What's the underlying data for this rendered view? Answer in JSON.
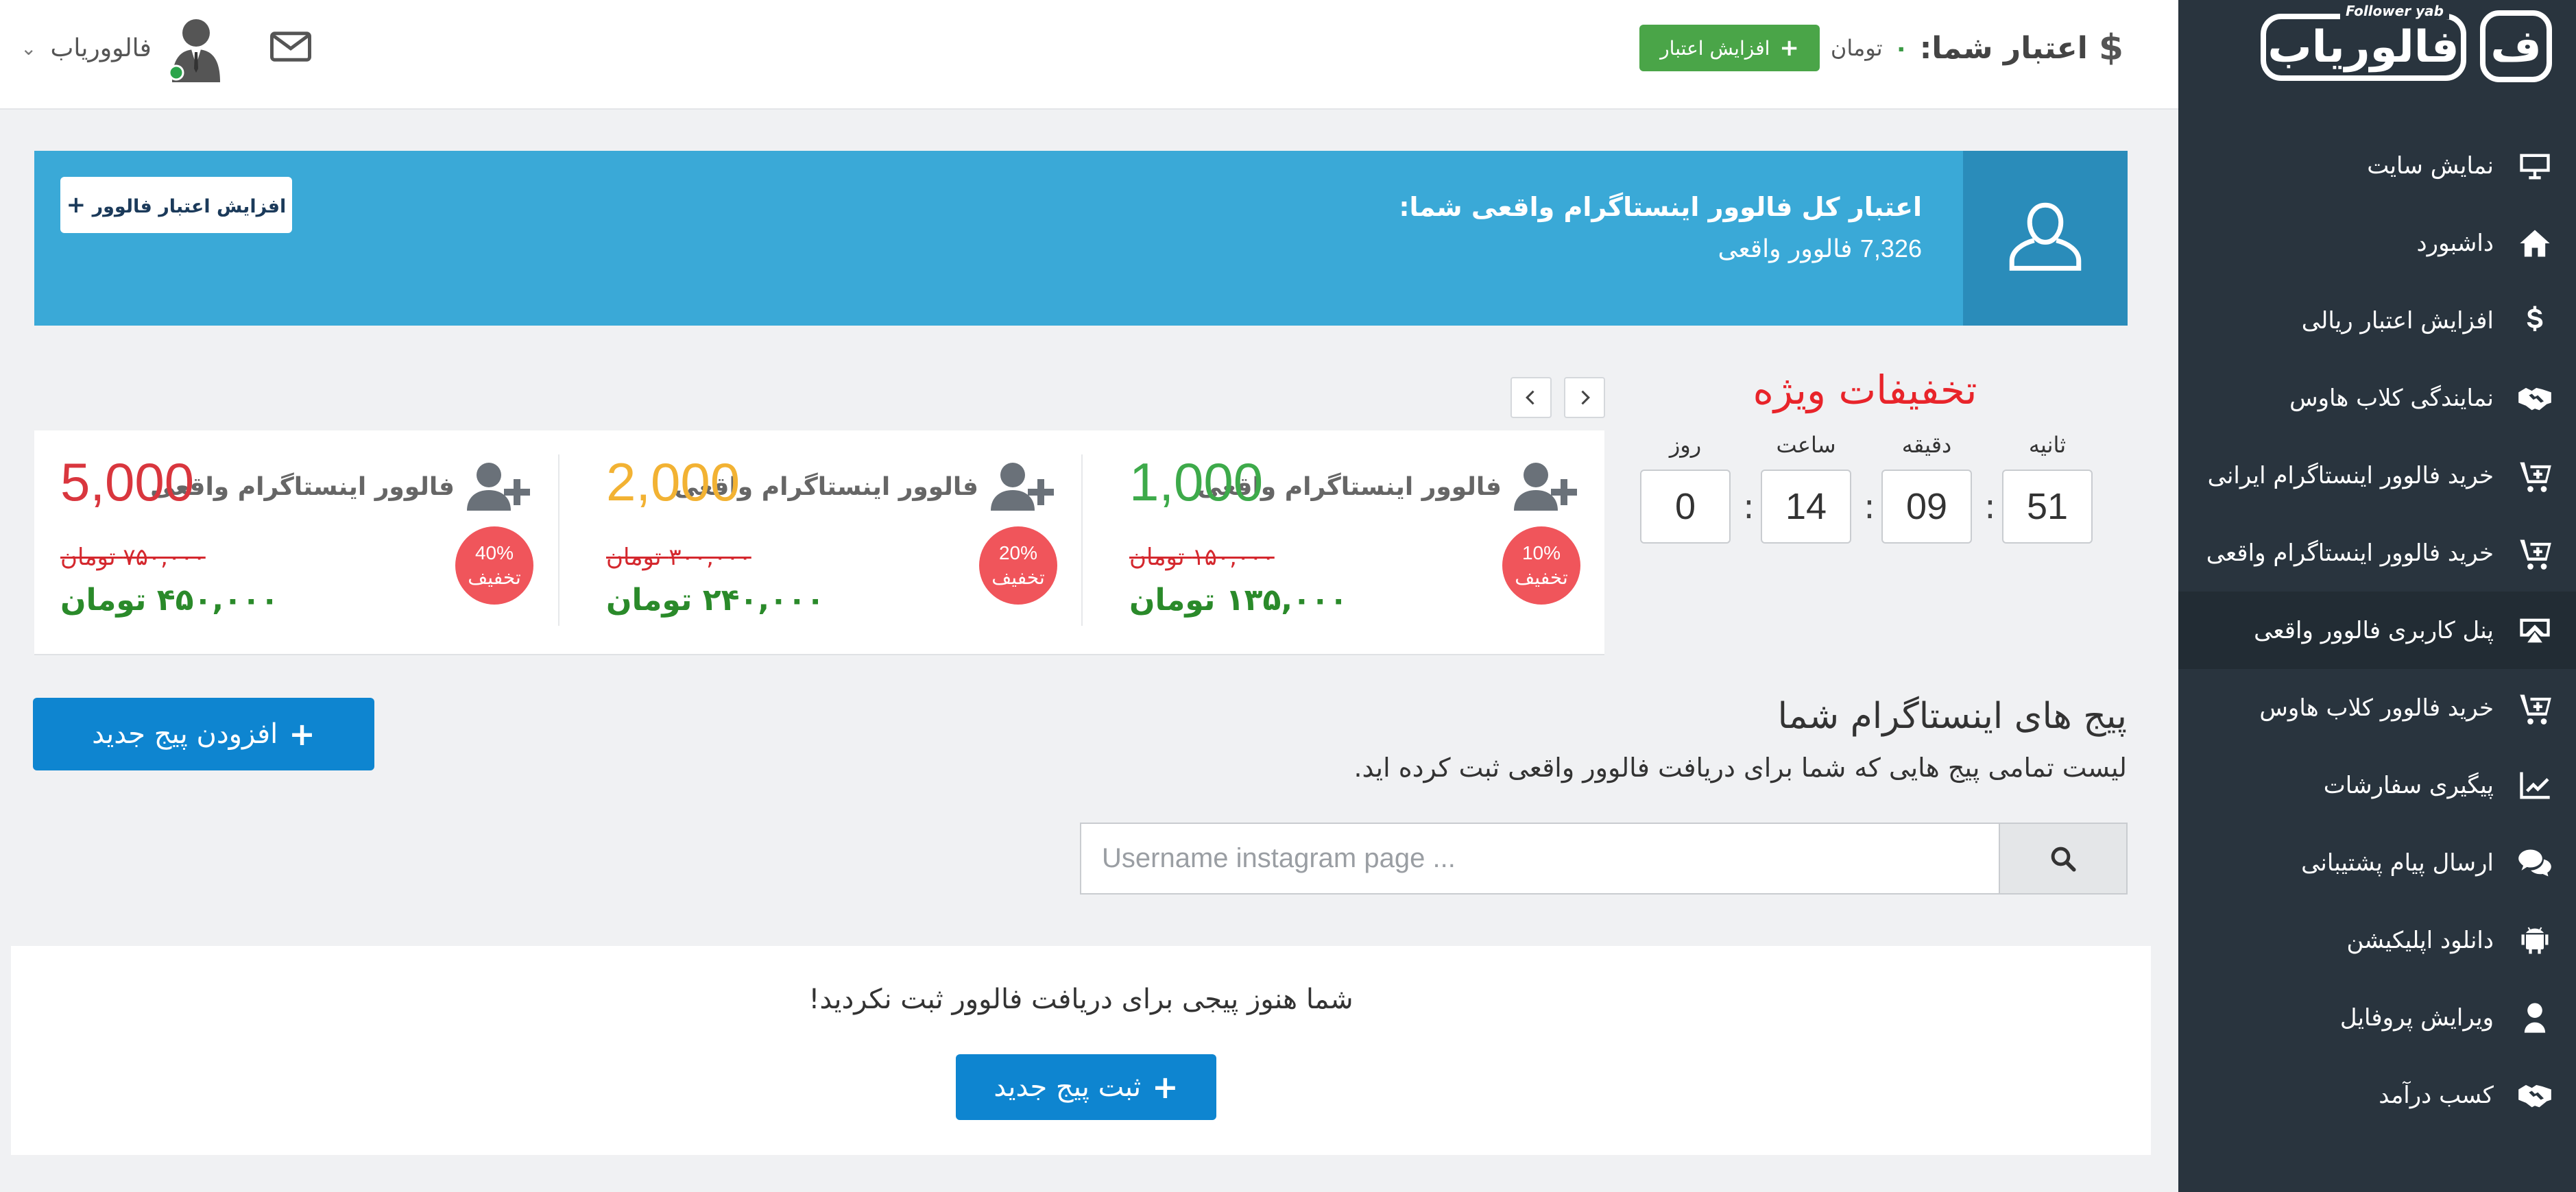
{
  "colors": {
    "sidebar_bg": "#29343e",
    "banner": "#3aa9d7",
    "banner_dark": "#2a8cba",
    "green": "#4aa548",
    "blue": "#0e85d0",
    "red": "#e8242a"
  },
  "logo": {
    "tag": "Follower yab",
    "wordmark": "فالوریاب",
    "badge": "ف"
  },
  "sidebar": {
    "items": [
      {
        "label": "نمایش سایت",
        "icon": "monitor-icon"
      },
      {
        "label": "داشبورد",
        "icon": "home-icon"
      },
      {
        "label": "افزایش اعتبار ریالی",
        "icon": "dollar-icon"
      },
      {
        "label": "نمایندگی کلاب هاوس",
        "icon": "handshake-icon"
      },
      {
        "label": "خرید فالوور اینستاگرام ایرانی",
        "icon": "cart-plus-icon"
      },
      {
        "label": "خرید فالوور اینستاگرام واقعی",
        "icon": "cart-plus-icon"
      },
      {
        "label": "پنل کاربری فالوور واقعی",
        "icon": "screen-share-icon"
      },
      {
        "label": "خرید فالوور کلاب هاوس",
        "icon": "cart-plus-icon"
      },
      {
        "label": "پیگیری سفارشات",
        "icon": "chart-line-icon"
      },
      {
        "label": "ارسال پیام پشتیبانی",
        "icon": "comments-icon"
      },
      {
        "label": "دانلود اپلیکیشن",
        "icon": "android-icon"
      },
      {
        "label": "ویرایش پروفایل",
        "icon": "user-icon"
      },
      {
        "label": "کسب درآمد",
        "icon": "handshake-icon"
      }
    ]
  },
  "topbar": {
    "credit_symbol": "$",
    "credit_label": "اعتبار شما:",
    "credit_value": "۰",
    "credit_unit": "تومان",
    "add_credit_label": "افزایش اعتبار",
    "username": "فالووریاب"
  },
  "banner": {
    "title": "اعتبار کل فالوور اینستاگرام واقعی شما:",
    "count": "7,326",
    "count_unit": "فالوور واقعی",
    "button_label": "افزایش اعتبار فالوور"
  },
  "offers": {
    "title": "تخفیفات ویژه",
    "countdown": {
      "seconds_label": "ثانیه",
      "seconds": "51",
      "minutes_label": "دقیقه",
      "minutes": "09",
      "hours_label": "ساعت",
      "hours": "14",
      "days_label": "روز",
      "days": "0"
    },
    "items": [
      {
        "name": "فالوور اینستاگرام واقعی",
        "count": "1,000",
        "count_color": "#3daa4a",
        "discount": "10%",
        "discount_label": "تخفیف",
        "old_price": "۱۵۰,۰۰۰ تومان",
        "new_price": "۱۳۵,۰۰۰ تومان"
      },
      {
        "name": "فالوور اینستاگرام واقعی",
        "count": "2,000",
        "count_color": "#f2b233",
        "discount": "20%",
        "discount_label": "تخفیف",
        "old_price": "۳۰۰,۰۰۰ تومان",
        "new_price": "۲۴۰,۰۰۰ تومان"
      },
      {
        "name": "فالوور اینستاگرام واقعی",
        "count": "5,000",
        "count_color": "#d9363e",
        "discount": "40%",
        "discount_label": "تخفیف",
        "old_price": "۷۵۰,۰۰۰ تومان",
        "new_price": "۴۵۰,۰۰۰ تومان"
      }
    ]
  },
  "pages": {
    "title": "پیج های اینستاگرام شما",
    "description": "لیست تمامی پیج هایی که شما برای دریافت فالوور واقعی ثبت کرده اید.",
    "add_button": "افزودن پیج جدید",
    "search_placeholder": "Username instagram page ...",
    "empty_message": "شما هنوز پیجی برای دریافت فالوور ثبت نکردید!",
    "register_button": "ثبت پیج جدید"
  }
}
